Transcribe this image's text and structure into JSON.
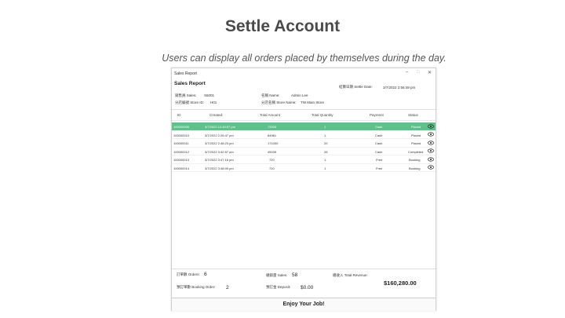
{
  "slide": {
    "title": "Settle Account",
    "subtitle": "Users can display all  orders placed by themselves during the day."
  },
  "window": {
    "title": "Sales Report",
    "min": "–",
    "max": "□",
    "close": "✕"
  },
  "report": {
    "heading": "Sales Report",
    "sales_label": "銷售員 Sales:",
    "sales_value": "S6001",
    "name_label": "名稱 Name:",
    "name_value": "Admin Lee",
    "settle_label": "結算日期 Settle Date:",
    "settle_value": "3/7/2022 2:56:49 pm",
    "store_id_label": "分店編號 Store ID:",
    "store_id_value": "H01",
    "store_name_label": "分店名稱 Store Name:",
    "store_name_value": "TW Main Store"
  },
  "table": {
    "headers": [
      "ID",
      "Created:",
      "Total Amount",
      "Total Quantity",
      "Payment",
      "Status"
    ],
    "rows": [
      [
        "100000009",
        "3/7/2022 12:49:57 pm",
        "72005",
        "1",
        "Cash",
        "Placed"
      ],
      [
        "100000010",
        "3/7/2022 2:26:47 pm",
        "84961",
        "1",
        "Cash",
        "Placed"
      ],
      [
        "100000011",
        "3/7/2022 2:48:23 pm",
        "171000",
        "20",
        "Cash",
        "Placed"
      ],
      [
        "100000012",
        "3/7/2022 3:42:57 pm",
        "45039",
        "26",
        "Cash",
        "Completed"
      ],
      [
        "100000013",
        "3/7/2022 3:47:16 pm",
        "720",
        "1",
        "Free",
        "Booking"
      ],
      [
        "100000014",
        "3/7/2022 3:48:09 pm",
        "720",
        "1",
        "Free",
        "Booking"
      ]
    ]
  },
  "footer": {
    "orders_label": "訂單數 Orders:",
    "orders_value": "6",
    "sales_label": "總銷量 Sales:",
    "sales_value": "58",
    "revenue_label": "總收入 Total Revenue:",
    "revenue_value": "$160,280.00",
    "booking_label": "預訂單數 Booking Order:",
    "booking_value": "2",
    "deposit_label": "預訂金 Deposit:",
    "deposit_value": "$0.00"
  },
  "bottom_message": "Enjoy Your Job!",
  "colors": {
    "selected_row": "#5ec08a"
  }
}
